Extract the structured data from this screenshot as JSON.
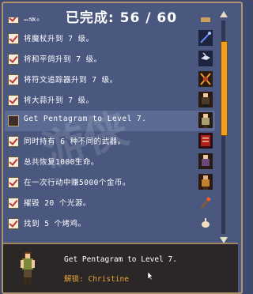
{
  "header": {
    "completed_label": "已完成:",
    "progress": "56 / 60",
    "completed": 56,
    "total": 60
  },
  "achievements": [
    {
      "text": "…级。",
      "checked": true,
      "icon": "scroll-icon"
    },
    {
      "text": "将魔杖升到 7 级。",
      "checked": true,
      "icon": "magic-wand-icon"
    },
    {
      "text": "将和平鸽升到 7 级。",
      "checked": true,
      "icon": "peace-dove-icon"
    },
    {
      "text": "将符文追踪器升到 7 级。",
      "checked": true,
      "icon": "runetracer-icon"
    },
    {
      "text": "将大蒜升到 7 级。",
      "checked": true,
      "icon": "garlic-character-icon"
    },
    {
      "text": "Get Pentagram to Level 7.",
      "checked": false,
      "icon": "pentagram-character-icon",
      "selected": true
    },
    {
      "text": "同时持有 6 种不同的武器。",
      "checked": true,
      "icon": "weapon-book-icon"
    },
    {
      "text": "总共恢复1000生命。",
      "checked": true,
      "icon": "healer-character-icon"
    },
    {
      "text": "在一次行动中赚5000个金币。",
      "checked": true,
      "icon": "gold-character-icon"
    },
    {
      "text": "摧毁 20 个光源。",
      "checked": true,
      "icon": "torch-icon"
    },
    {
      "text": "找到 5 个烤鸡。",
      "checked": true,
      "icon": "chicken-icon"
    }
  ],
  "detail": {
    "description": "Get Pentagram to Level 7.",
    "unlock_label": "解锁:",
    "unlock_name": "Christine"
  },
  "colors": {
    "panel": "#4a587f",
    "accent": "#f0a020",
    "unlock": "#e8a33a",
    "check": "#c0392b"
  }
}
